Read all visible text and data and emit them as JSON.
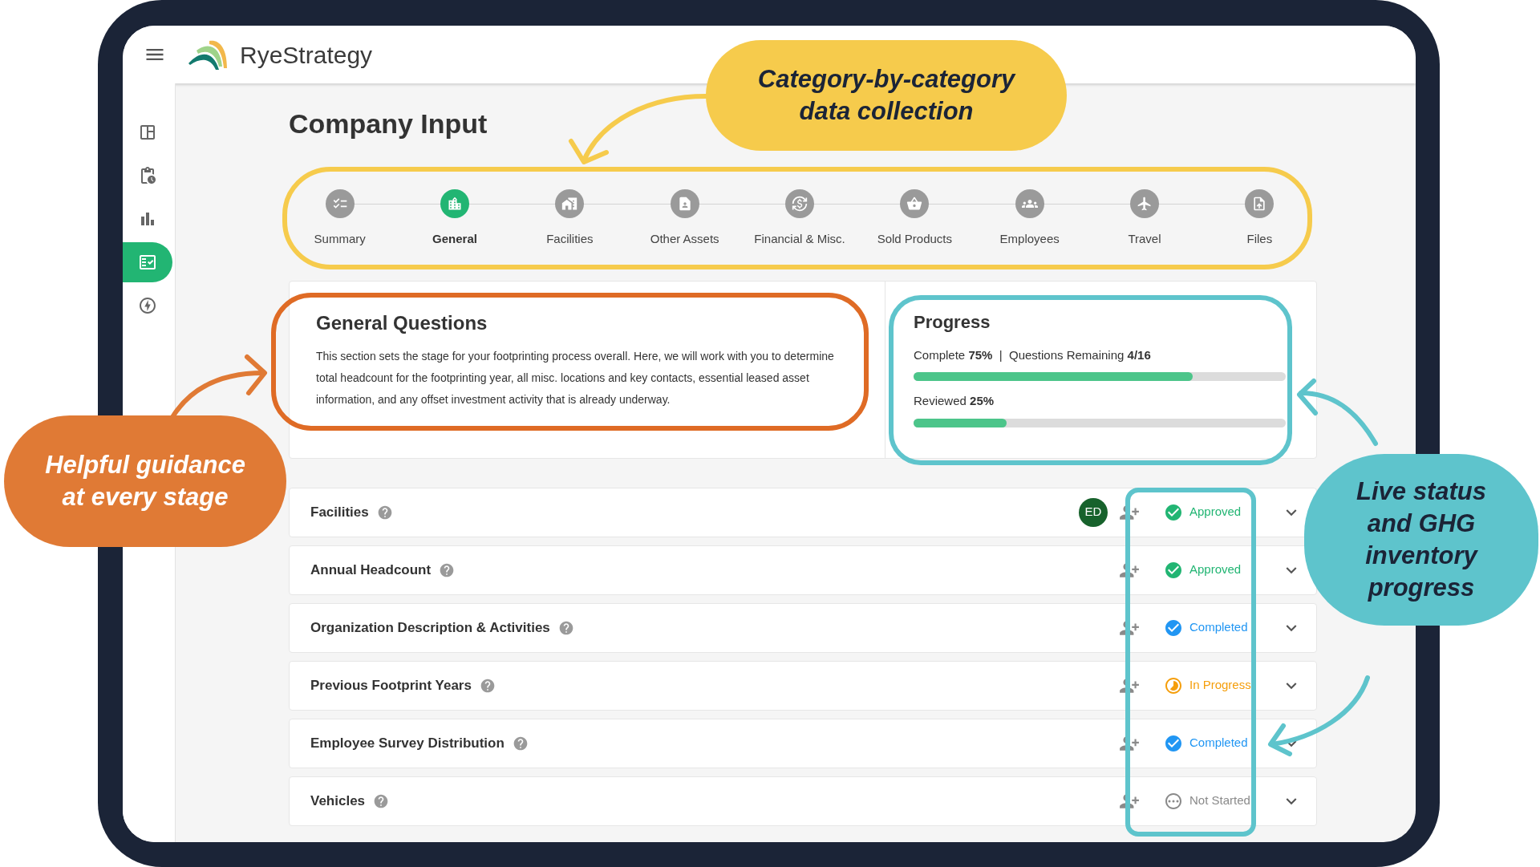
{
  "brand": "**Rye**Strategy",
  "sidebar": {
    "items": [
      {
        "selected": false
      },
      {
        "selected": false
      },
      {
        "selected": false
      },
      {
        "selected": true
      },
      {
        "selected": false
      }
    ]
  },
  "page_title": "Company Input",
  "steps": [
    {
      "label": "Summary",
      "selected": false
    },
    {
      "label": "General",
      "selected": true
    },
    {
      "label": "Facilities",
      "selected": false
    },
    {
      "label": "Other Assets",
      "selected": false
    },
    {
      "label": "Financial & Misc.",
      "selected": false
    },
    {
      "label": "Sold Products",
      "selected": false
    },
    {
      "label": "Employees",
      "selected": false
    },
    {
      "label": "Travel",
      "selected": false
    },
    {
      "label": "Files",
      "selected": false
    }
  ],
  "general": {
    "title": "General Questions",
    "description": "This section sets the stage for your footprinting process overall. Here, we will work with you to determine total headcount for the footprinting year, all misc. locations and key contacts, essential leased asset information, and any offset investment activity that is already underway."
  },
  "progress": {
    "title": "Progress",
    "bars": [
      {
        "text": "Complete **75%**  |  Questions Remaining **4/16**",
        "level": 0.75
      },
      {
        "text": "Reviewed **25%**",
        "level": 0.25
      }
    ]
  },
  "questions": [
    {
      "title": "Facilities",
      "avatar": "ED",
      "status": {
        "kind": "approved",
        "label": "Approved"
      }
    },
    {
      "title": "Annual Headcount",
      "status": {
        "kind": "approved",
        "label": "Approved"
      }
    },
    {
      "title": "Organization Description & Activities",
      "status": {
        "kind": "completed",
        "label": "Completed"
      }
    },
    {
      "title": "Previous Footprint Years",
      "status": {
        "kind": "in_progress",
        "label": "In Progress"
      }
    },
    {
      "title": "Employee Survey Distribution",
      "status": {
        "kind": "completed",
        "label": "Completed"
      }
    },
    {
      "title": "Vehicles",
      "status": {
        "kind": "not_started",
        "label": "Not Started"
      }
    }
  ],
  "callouts": [
    {
      "kind": "top",
      "text": "Category-by-category data collection",
      "color": "#f6cb4c"
    },
    {
      "kind": "left",
      "text": "Helpful guidance at every stage",
      "color": "#e07a35"
    },
    {
      "kind": "right",
      "text": "Live status and GHG inventory progress",
      "color": "#5ec4cc"
    }
  ]
}
